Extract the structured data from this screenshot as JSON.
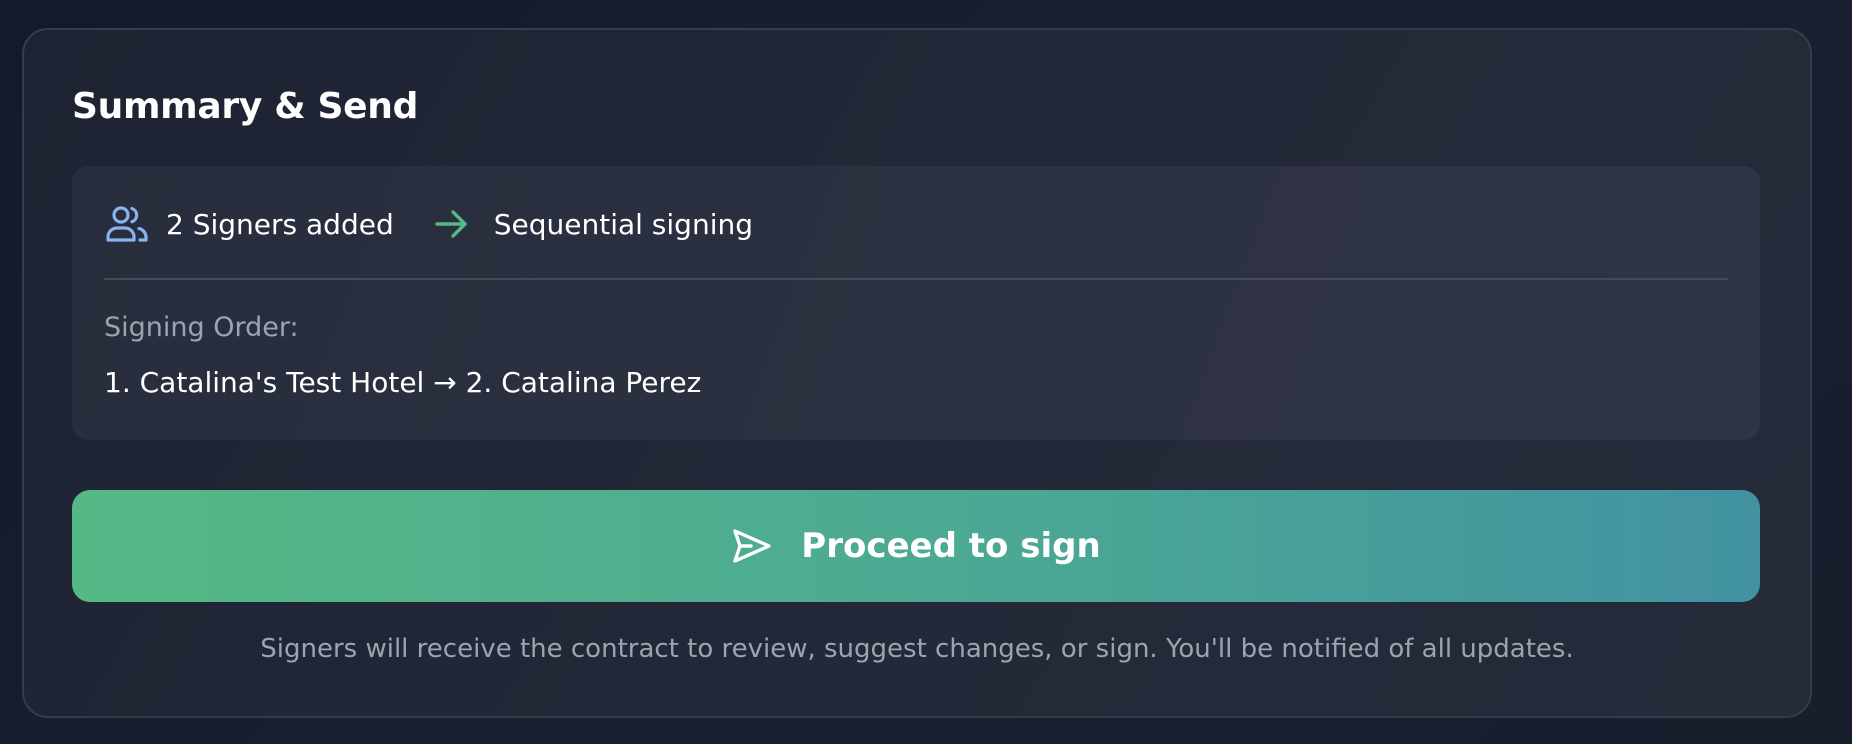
{
  "summary": {
    "title": "Summary & Send",
    "signers_count_text": "2 Signers added",
    "signing_mode": "Sequential signing",
    "order_label": "Signing Order:",
    "order_value": "1. Catalina's Test Hotel → 2. Catalina Perez"
  },
  "action": {
    "proceed_label": "Proceed to sign"
  },
  "footer": {
    "note": "Signers will receive the contract to review, suggest changes, or sign. You'll be notified of all updates."
  },
  "icons": {
    "signers": "users-icon",
    "mode": "arrow-right-icon",
    "proceed": "send-icon"
  },
  "colors": {
    "background": "#171d2b",
    "card": "#222837",
    "summary_box": "#2c3141",
    "users_icon": "#8ab2f0",
    "arrow_icon": "#55b985",
    "button_start": "#55b985",
    "button_end": "#4292a1",
    "muted_text": "#9ea3b0"
  }
}
